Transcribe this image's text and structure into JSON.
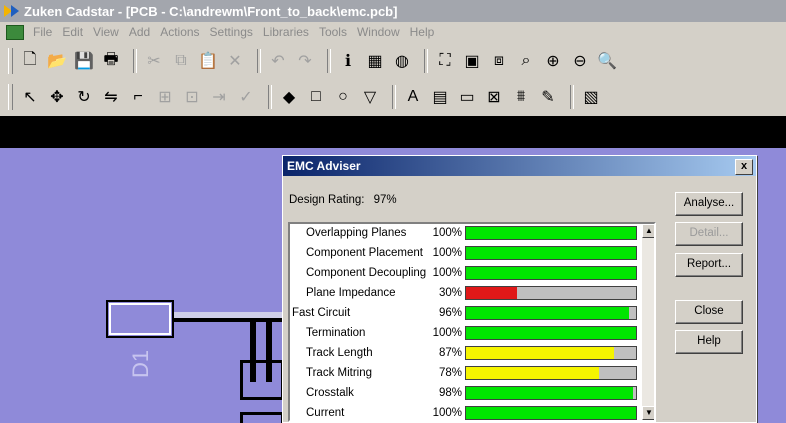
{
  "app": {
    "title": "Zuken Cadstar - [PCB - C:\\andrewm\\Front_to_back\\emc.pcb]"
  },
  "menu": [
    "File",
    "Edit",
    "View",
    "Add",
    "Actions",
    "Settings",
    "Libraries",
    "Tools",
    "Window",
    "Help"
  ],
  "toolbar1": [
    {
      "icon": "new-file-icon",
      "glyph": "🗋",
      "enabled": true
    },
    {
      "icon": "open-folder-icon",
      "glyph": "📂",
      "enabled": true
    },
    {
      "icon": "save-icon",
      "glyph": "💾",
      "enabled": true
    },
    {
      "icon": "print-icon",
      "glyph": "🖶",
      "enabled": true
    },
    {
      "icon": "cut-icon",
      "glyph": "✂",
      "enabled": false
    },
    {
      "icon": "copy-icon",
      "glyph": "⧉",
      "enabled": false
    },
    {
      "icon": "paste-icon",
      "glyph": "📋",
      "enabled": false
    },
    {
      "icon": "delete-icon",
      "glyph": "✕",
      "enabled": false
    },
    {
      "icon": "undo-icon",
      "glyph": "↶",
      "enabled": false
    },
    {
      "icon": "redo-icon",
      "glyph": "↷",
      "enabled": false
    },
    {
      "icon": "info-icon",
      "glyph": "ℹ",
      "enabled": true
    },
    {
      "icon": "grid-icon",
      "glyph": "▦",
      "enabled": true
    },
    {
      "icon": "color-palette-icon",
      "glyph": "◍",
      "enabled": true
    },
    {
      "icon": "zoom-fit-icon",
      "glyph": "⛶",
      "enabled": true
    },
    {
      "icon": "zoom-window-icon",
      "glyph": "▣",
      "enabled": true
    },
    {
      "icon": "zoom-previous-icon",
      "glyph": "⧈",
      "enabled": true
    },
    {
      "icon": "zoom-select-icon",
      "glyph": "⌕",
      "enabled": true
    },
    {
      "icon": "zoom-in-icon",
      "glyph": "⊕",
      "enabled": true
    },
    {
      "icon": "zoom-out-icon",
      "glyph": "⊖",
      "enabled": true
    },
    {
      "icon": "zoom-all-icon",
      "glyph": "🔍",
      "enabled": true
    }
  ],
  "toolbar2": [
    {
      "icon": "select-pointer-icon",
      "glyph": "↖",
      "enabled": true
    },
    {
      "icon": "move-icon",
      "glyph": "✥",
      "enabled": true
    },
    {
      "icon": "rotate-icon",
      "glyph": "↻",
      "enabled": true
    },
    {
      "icon": "mirror-icon",
      "glyph": "⇋",
      "enabled": true
    },
    {
      "icon": "route-track-icon",
      "glyph": "⌐",
      "enabled": true
    },
    {
      "icon": "add-component-icon",
      "glyph": "⊞",
      "enabled": false
    },
    {
      "icon": "add-via-icon",
      "glyph": "⊡",
      "enabled": false
    },
    {
      "icon": "connect-icon",
      "glyph": "⇥",
      "enabled": false
    },
    {
      "icon": "check-icon",
      "glyph": "✓",
      "enabled": false
    },
    {
      "icon": "shape-icon",
      "glyph": "◆",
      "enabled": true
    },
    {
      "icon": "rectangle-icon",
      "glyph": "□",
      "enabled": true
    },
    {
      "icon": "circle-icon",
      "glyph": "○",
      "enabled": true
    },
    {
      "icon": "polygon-icon",
      "glyph": "▽",
      "enabled": true
    },
    {
      "icon": "text-icon",
      "glyph": "A",
      "enabled": true
    },
    {
      "icon": "dimension-icon",
      "glyph": "▤",
      "enabled": true
    },
    {
      "icon": "layer-icon",
      "glyph": "▭",
      "enabled": true
    },
    {
      "icon": "design-rules-icon",
      "glyph": "⊠",
      "enabled": true
    },
    {
      "icon": "autorouter-icon",
      "glyph": "⩩",
      "enabled": true
    },
    {
      "icon": "edit-icon",
      "glyph": "✎",
      "enabled": true
    },
    {
      "icon": "report-icon",
      "glyph": "▧",
      "enabled": true
    }
  ],
  "canvas": {
    "designator": "D1"
  },
  "dialog": {
    "title": "EMC Adviser",
    "close_label": "x",
    "rating_label": "Design Rating:",
    "rating_value": "97%",
    "buttons": {
      "analyse": "Analyse...",
      "detail": "Detail...",
      "report": "Report...",
      "close": "Close",
      "help": "Help"
    },
    "rows": [
      {
        "name": "Overlapping Planes",
        "pct": "100%",
        "value": 100,
        "color": "green",
        "indent": 1
      },
      {
        "name": "Component Placement",
        "pct": "100%",
        "value": 100,
        "color": "green",
        "indent": 1
      },
      {
        "name": "Component Decoupling",
        "pct": "100%",
        "value": 100,
        "color": "green",
        "indent": 1
      },
      {
        "name": "Plane Impedance",
        "pct": "30%",
        "value": 30,
        "color": "red",
        "indent": 1
      },
      {
        "name": "Fast Circuit",
        "pct": "96%",
        "value": 96,
        "color": "green",
        "indent": 0
      },
      {
        "name": "Termination",
        "pct": "100%",
        "value": 100,
        "color": "green",
        "indent": 1
      },
      {
        "name": "Track Length",
        "pct": "87%",
        "value": 87,
        "color": "yellow",
        "indent": 1
      },
      {
        "name": "Track Mitring",
        "pct": "78%",
        "value": 78,
        "color": "yellow",
        "indent": 1
      },
      {
        "name": "Crosstalk",
        "pct": "98%",
        "value": 98,
        "color": "green",
        "indent": 1
      },
      {
        "name": "Current",
        "pct": "100%",
        "value": 100,
        "color": "green",
        "indent": 1
      }
    ]
  }
}
